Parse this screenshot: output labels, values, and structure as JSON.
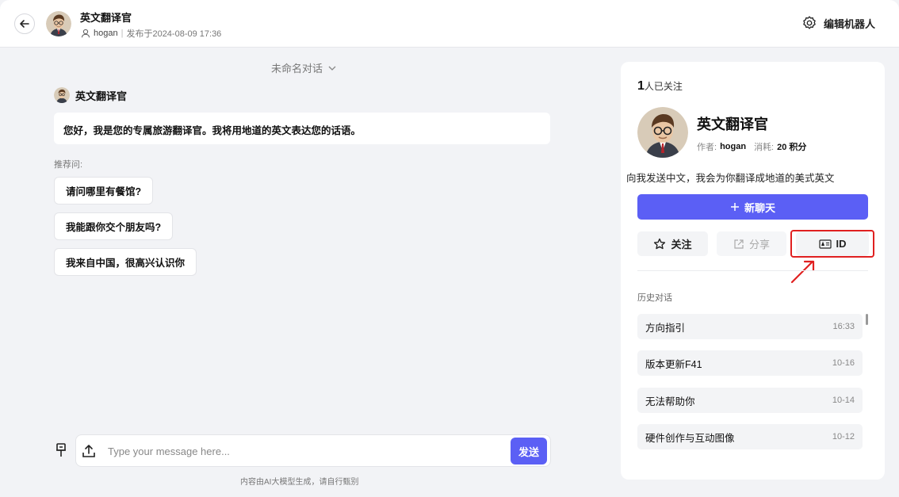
{
  "header": {
    "bot_name": "英文翻译官",
    "author": "hogan",
    "separator": "|",
    "published": "发布于2024-08-09 17:36",
    "edit_bot_label": "编辑机器人"
  },
  "chat": {
    "conversation_title": "未命名对话",
    "bot_name": "英文翻译官",
    "greeting": "您好，我是您的专属旅游翻译官。我将用地道的英文表达您的话语。",
    "recommend_label": "推荐问:",
    "suggestions": [
      "请问哪里有餐馆?",
      "我能跟你交个朋友吗?",
      "我来自中国，很高兴认识你"
    ],
    "input_placeholder": "Type your message here...",
    "send_label": "发送",
    "disclaimer": "内容由AI大模型生成，请自行甄别"
  },
  "panel": {
    "follower_count": "1",
    "follower_suffix": "人已关注",
    "bot_name": "英文翻译官",
    "author_label": "作者:",
    "author": "hogan",
    "cost_label": "消耗:",
    "cost": "20 积分",
    "description": "向我发送中文，我会为你翻译成地道的美式英文",
    "new_chat_label": "新聊天",
    "follow_label": "关注",
    "share_label": "分享",
    "id_label": "ID",
    "history_label": "历史对话",
    "history": [
      {
        "title": "方向指引",
        "time": "16:33"
      },
      {
        "title": "版本更新F41",
        "time": "10-16"
      },
      {
        "title": "无法帮助你",
        "time": "10-14"
      },
      {
        "title": "硬件创作与互动图像",
        "time": "10-12"
      }
    ]
  },
  "colors": {
    "accent": "#5b5ff5",
    "highlight": "#e02020"
  },
  "icons": {
    "back": "arrow-left-icon",
    "user": "user-icon",
    "settings": "gear-icon",
    "chevron": "chevron-down-icon",
    "pin": "pin-icon",
    "upload": "upload-icon",
    "plus": "plus-icon",
    "star": "star-icon",
    "share": "share-icon",
    "id_card": "id-card-icon"
  }
}
